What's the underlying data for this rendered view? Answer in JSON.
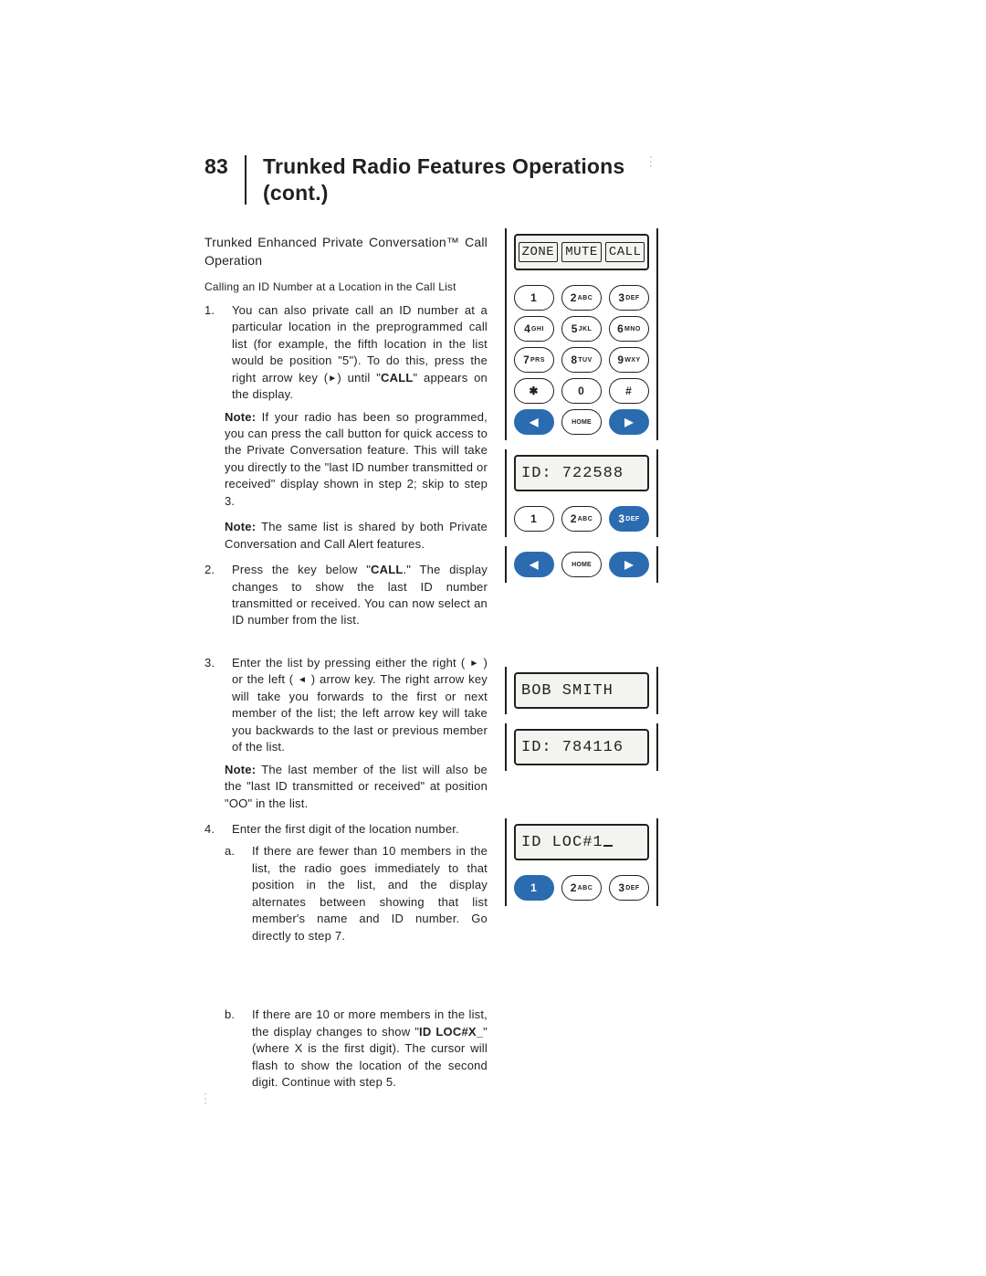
{
  "page_number": "83",
  "title_line1": "Trunked Radio Features Operations",
  "title_line2": "(cont.)",
  "subhead": "Trunked Enhanced Private Conversation™ Call Operation",
  "mini_head": "Calling an ID Number at a Location in the Call List",
  "step1_num": "1.",
  "step1_a": "You can also private call an ID number at a particular location in the preprogrammed call list (for example, the fifth location in the list would be position \"5\"). To do this, press the right arrow key (",
  "step1_b": ") until \"",
  "step1_call": "CALL",
  "step1_c": "\" appears on the display.",
  "note1_lead": "Note:",
  "note1_body": " If your radio has been so programmed, you can press the call button for quick access to the Private Conversation feature. This will take you directly to the \"last ID number transmitted or received\" display shown in step 2; skip to step 3.",
  "note2_lead": "Note:",
  "note2_body": " The same list is shared by both Private Conversation and Call Alert features.",
  "step2_num": "2.",
  "step2_a": "Press the key below \"",
  "step2_call": "CALL",
  "step2_b": ".\" The display changes to show the last ID number transmitted or received. You can now select an ID number from the list.",
  "step3_num": "3.",
  "step3_a": "Enter the list by pressing either the right ( ",
  "step3_b": " ) or the left ( ",
  "step3_c": " ) arrow key. The right arrow key will take you forwards to the first or next member of the list; the left arrow key will take you backwards to the last or previous member of the list.",
  "note3_lead": "Note:",
  "note3_body": " The last member of the list will also be the \"last ID transmitted or received\" at position \"OO\" in the list.",
  "step4_num": "4.",
  "step4": "Enter the first digit of the location number.",
  "step4a_num": "a.",
  "step4a": "If there are fewer than 10 members in the list, the radio goes immediately to that position in the list, and the display alternates between showing that list member's name and ID number. Go directly to step 7.",
  "step4b_num": "b.",
  "step4b_a": "If there are 10 or more members in the list, the display changes to show \"",
  "step4b_loc": "ID LOC#X_",
  "step4b_b": "\" (where X is the first digit). The cursor will flash to show the location of the second digit. Continue with step 5.",
  "softkeys": {
    "zone": "ZONE",
    "mute": "MUTE",
    "call": "CALL"
  },
  "keypad": {
    "k1": "1",
    "k2": "2",
    "k2s": "ABC",
    "k3": "3",
    "k3s": "DEF",
    "k4": "4",
    "k4s": "GHI",
    "k5": "5",
    "k5s": "JKL",
    "k6": "6",
    "k6s": "MNO",
    "k7": "7",
    "k7s": "PRS",
    "k8": "8",
    "k8s": "TUV",
    "k9": "9",
    "k9s": "WXY",
    "kstar": "✱",
    "k0": "0",
    "khash": "#",
    "left": "◀",
    "home": "HOME",
    "right": "▶"
  },
  "lcd2": "ID: 722588",
  "lcd4a": "BOB SMITH",
  "lcd4b": "ID: 784116",
  "lcd5": "ID LOC#1"
}
